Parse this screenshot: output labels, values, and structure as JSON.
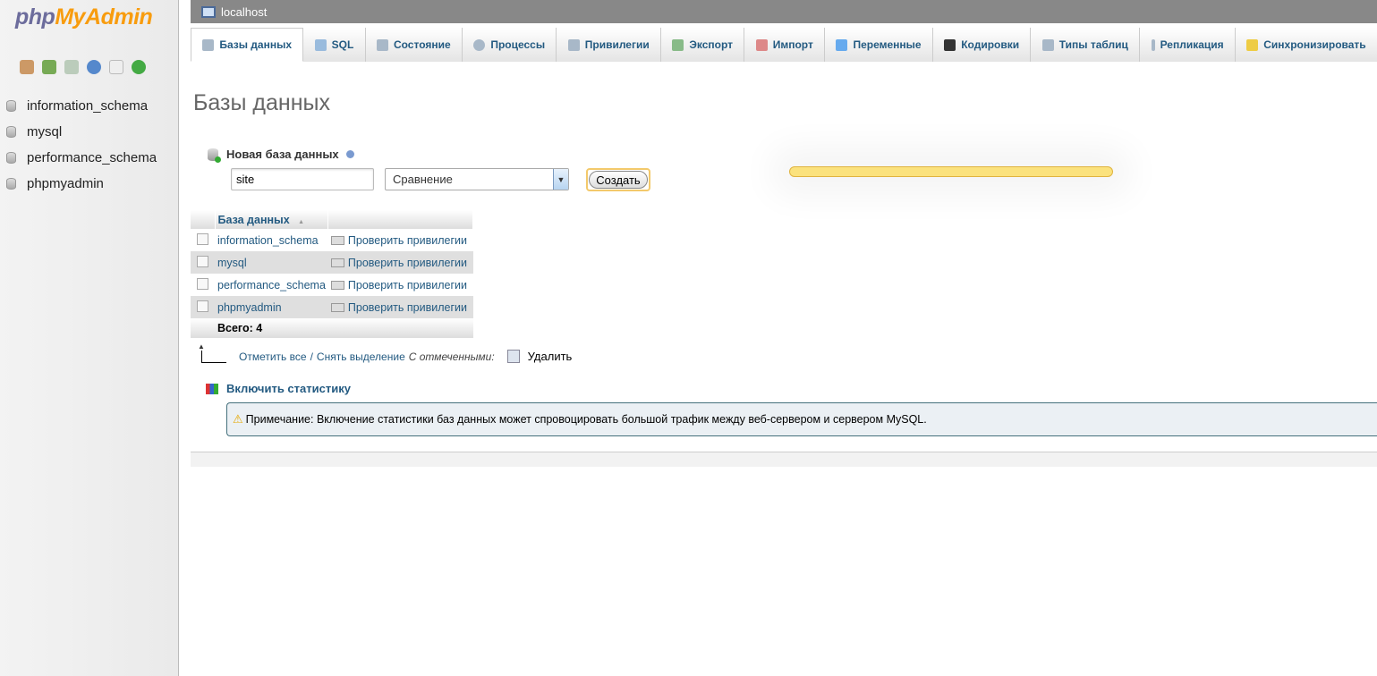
{
  "nav": {
    "logo_a": "php",
    "logo_b": "MyAdmin",
    "icons": [
      "home-icon",
      "logout-icon",
      "query-window-icon",
      "help-icon",
      "docs-icon",
      "reload-icon"
    ],
    "databases": [
      "information_schema",
      "mysql",
      "performance_schema",
      "phpmyadmin"
    ]
  },
  "top": {
    "server": "localhost"
  },
  "tabs": [
    {
      "label": "Базы данных"
    },
    {
      "label": "SQL"
    },
    {
      "label": "Состояние"
    },
    {
      "label": "Процессы"
    },
    {
      "label": "Привилегии"
    },
    {
      "label": "Экспорт"
    },
    {
      "label": "Импорт"
    },
    {
      "label": "Переменные"
    },
    {
      "label": "Кодировки"
    },
    {
      "label": "Типы таблиц"
    },
    {
      "label": "Репликация"
    },
    {
      "label": "Синхронизировать"
    }
  ],
  "page_title": "Базы данных",
  "create": {
    "label": "Новая база данных",
    "name_value": "site",
    "collation": "Сравнение",
    "button": "Создать"
  },
  "table": {
    "header": "База данных",
    "sort_arrow": "▲",
    "rows": [
      {
        "name": "information_schema",
        "action": "Проверить привилегии"
      },
      {
        "name": "mysql",
        "action": "Проверить привилегии"
      },
      {
        "name": "performance_schema",
        "action": "Проверить привилегии"
      },
      {
        "name": "phpmyadmin",
        "action": "Проверить привилегии"
      }
    ],
    "total": "Всего: 4"
  },
  "selection": {
    "check_all": "Отметить все",
    "sep": "/",
    "uncheck_all": "Снять выделение",
    "with_selected": "С отмеченными:",
    "drop": "Удалить"
  },
  "stats": {
    "label": "Включить статистику",
    "notice": "Примечание: Включение статистики баз данных может спровоцировать большой трафик между веб-сервером и сервером MySQL."
  }
}
